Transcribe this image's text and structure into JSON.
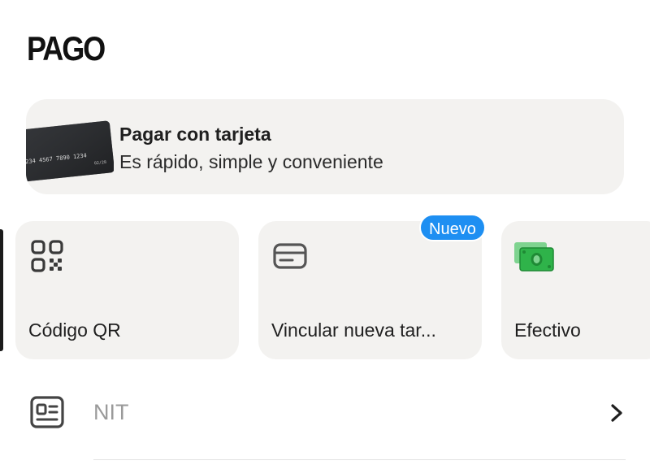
{
  "header": {
    "title": "PAGO"
  },
  "promo": {
    "title": "Pagar con tarjeta",
    "subtitle": "Es rápido, simple y conveniente",
    "card_number": "234 4567 7890 1234",
    "card_expiry": "02/28",
    "icon": "credit-card-image"
  },
  "payment_methods": [
    {
      "label": "Código QR",
      "icon": "qr-code-icon"
    },
    {
      "label": "Vincular nueva tar...",
      "icon": "card-outline-icon",
      "badge": "Nuevo"
    },
    {
      "label": "Efectivo",
      "icon": "cash-icon"
    }
  ],
  "nit": {
    "label": "NIT",
    "icon": "id-card-icon"
  },
  "colors": {
    "badge": "#1e8ff2",
    "tile_bg": "#f3f2f0",
    "cash_green": "#2fb34a"
  }
}
